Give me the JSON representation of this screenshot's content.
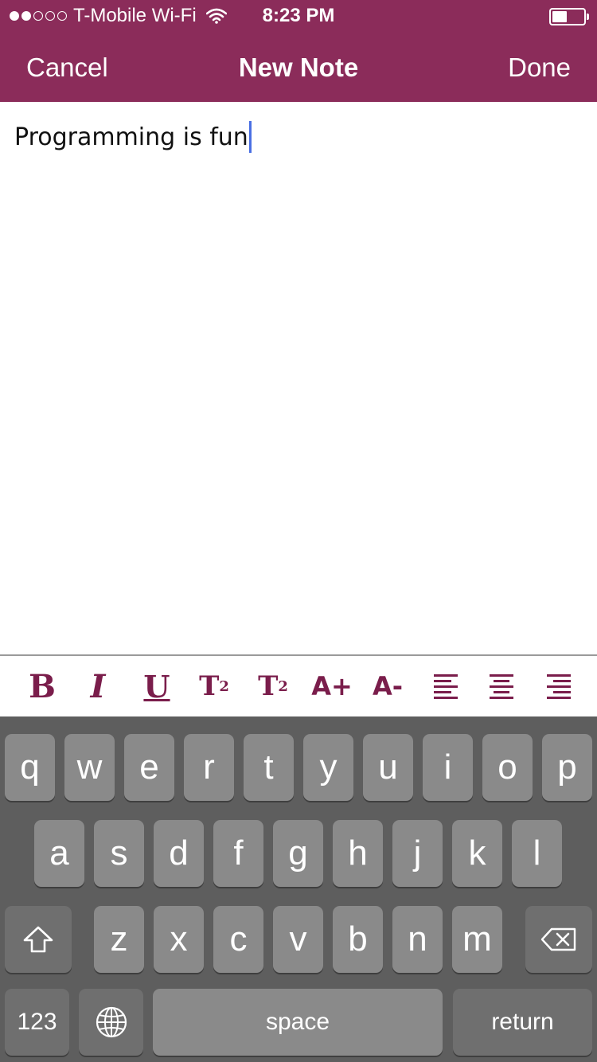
{
  "status_bar": {
    "carrier": "T-Mobile Wi-Fi",
    "time": "8:23 PM",
    "signal_filled": 2,
    "signal_total": 5
  },
  "nav": {
    "cancel_label": "Cancel",
    "title": "New Note",
    "done_label": "Done"
  },
  "editor": {
    "text": "Programming is fun"
  },
  "toolbar": {
    "bold": "B",
    "italic": "I",
    "underline": "U",
    "superscript_base": "T",
    "superscript_mark": "2",
    "subscript_base": "T",
    "subscript_mark": "2",
    "increase_font": "A+",
    "decrease_font": "A-",
    "accent_color": "#7a1d4b"
  },
  "keyboard": {
    "row1": [
      "q",
      "w",
      "e",
      "r",
      "t",
      "y",
      "u",
      "i",
      "o",
      "p"
    ],
    "row2": [
      "a",
      "s",
      "d",
      "f",
      "g",
      "h",
      "j",
      "k",
      "l"
    ],
    "row3": [
      "z",
      "x",
      "c",
      "v",
      "b",
      "n",
      "m"
    ],
    "numbers_label": "123",
    "space_label": "space",
    "return_label": "return"
  },
  "colors": {
    "header_bg": "#8b2c5a",
    "keyboard_bg": "#5e5e5e",
    "caret": "#4a6fe3"
  }
}
